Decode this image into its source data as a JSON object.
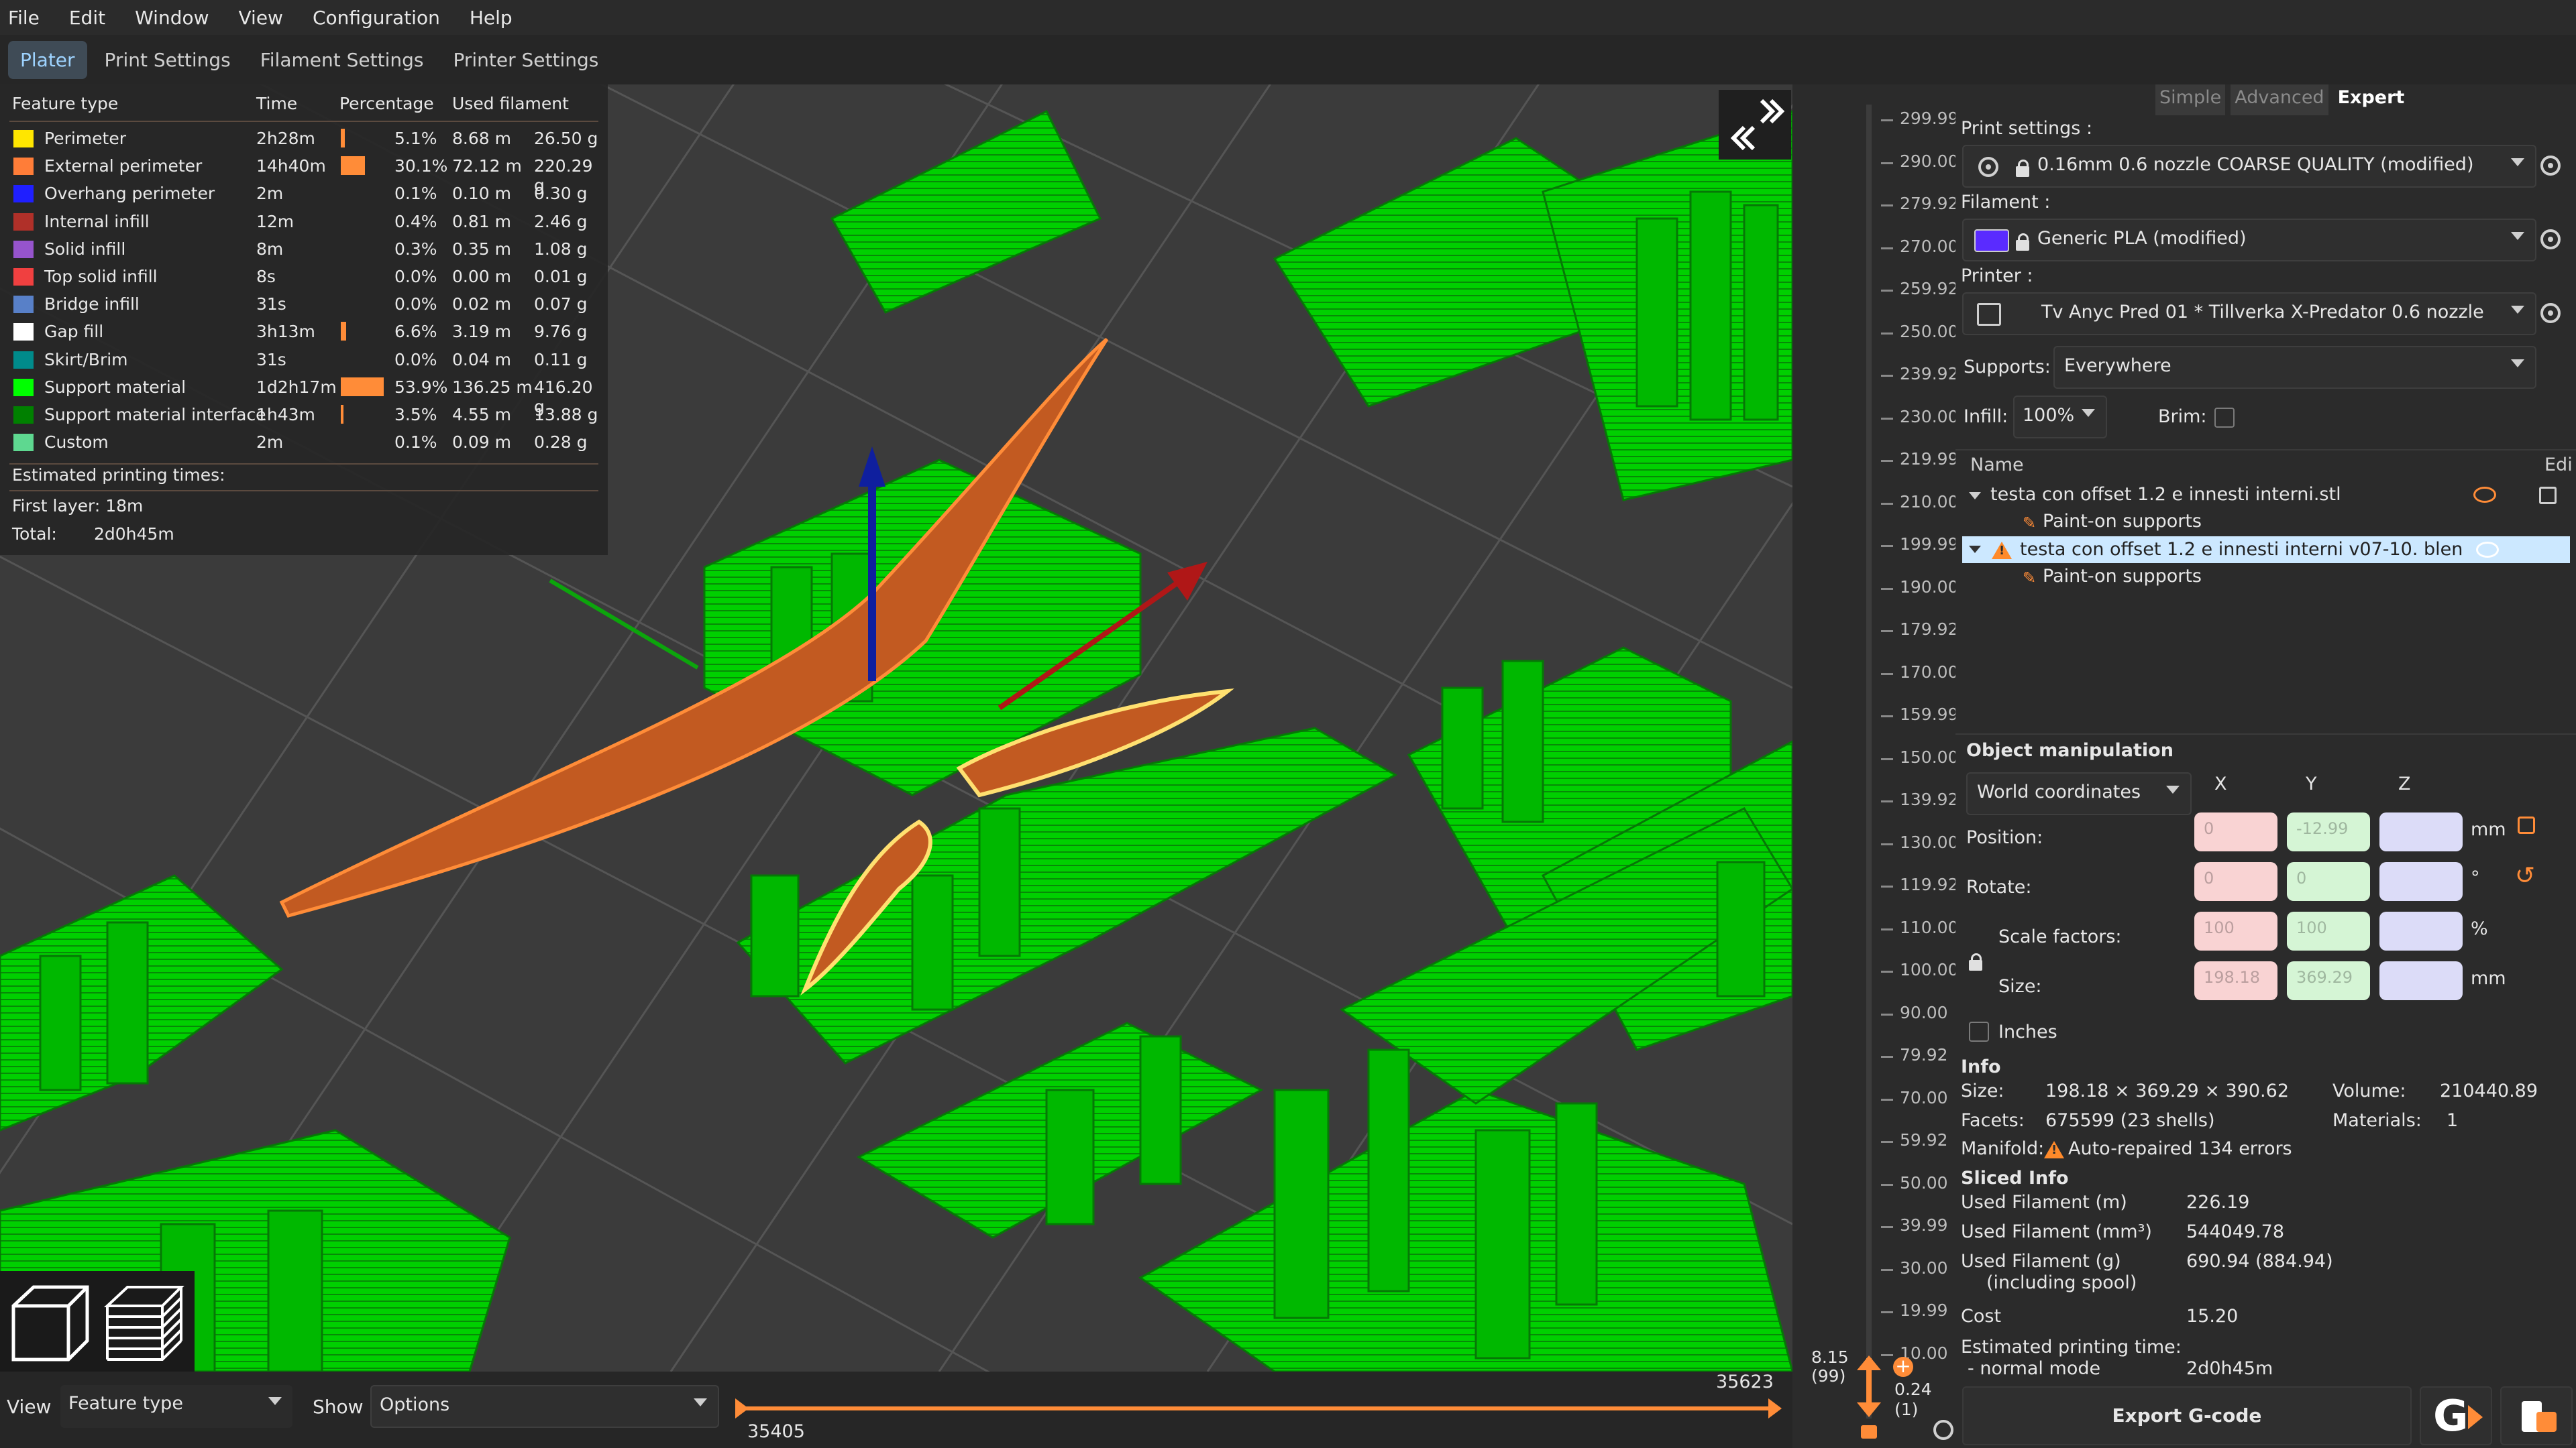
{
  "menu": [
    "File",
    "Edit",
    "Window",
    "View",
    "Configuration",
    "Help"
  ],
  "tabs": [
    {
      "label": "Plater",
      "active": true
    },
    {
      "label": "Print Settings",
      "active": false
    },
    {
      "label": "Filament Settings",
      "active": false
    },
    {
      "label": "Printer Settings",
      "active": false
    }
  ],
  "legend": {
    "headers": {
      "feature": "Feature type",
      "time": "Time",
      "percentage": "Percentage",
      "used": "Used filament"
    },
    "rows": [
      {
        "color": "#ffe600",
        "name": "Perimeter",
        "time": "2h28m",
        "pct": "5.1%",
        "pct_value": 5.1,
        "len": "8.68 m",
        "weight": "26.50 g"
      },
      {
        "color": "#ff7d38",
        "name": "External perimeter",
        "time": "14h40m",
        "pct": "30.1%",
        "pct_value": 30.1,
        "len": "72.12 m",
        "weight": "220.29 g"
      },
      {
        "color": "#1f1fff",
        "name": "Overhang perimeter",
        "time": "2m",
        "pct": "0.1%",
        "pct_value": 0.1,
        "len": "0.10 m",
        "weight": "0.30 g"
      },
      {
        "color": "#b03029",
        "name": "Internal infill",
        "time": "12m",
        "pct": "0.4%",
        "pct_value": 0.4,
        "len": "0.81 m",
        "weight": "2.46 g"
      },
      {
        "color": "#9654cc",
        "name": "Solid infill",
        "time": "8m",
        "pct": "0.3%",
        "pct_value": 0.3,
        "len": "0.35 m",
        "weight": "1.08 g"
      },
      {
        "color": "#f04040",
        "name": "Top solid infill",
        "time": "8s",
        "pct": "0.0%",
        "pct_value": 0.0,
        "len": "0.00 m",
        "weight": "0.01 g"
      },
      {
        "color": "#5880c8",
        "name": "Bridge infill",
        "time": "31s",
        "pct": "0.0%",
        "pct_value": 0.0,
        "len": "0.02 m",
        "weight": "0.07 g"
      },
      {
        "color": "#ffffff",
        "name": "Gap fill",
        "time": "3h13m",
        "pct": "6.6%",
        "pct_value": 6.6,
        "len": "3.19 m",
        "weight": "9.76 g"
      },
      {
        "color": "#008b8b",
        "name": "Skirt/Brim",
        "time": "31s",
        "pct": "0.0%",
        "pct_value": 0.0,
        "len": "0.04 m",
        "weight": "0.11 g"
      },
      {
        "color": "#00ff00",
        "name": "Support material",
        "time": "1d2h17m",
        "pct": "53.9%",
        "pct_value": 53.9,
        "len": "136.25 m",
        "weight": "416.20 g"
      },
      {
        "color": "#008000",
        "name": "Support material interface",
        "time": "1h43m",
        "pct": "3.5%",
        "pct_value": 3.5,
        "len": "4.55 m",
        "weight": "13.88 g"
      },
      {
        "color": "#5ed890",
        "name": "Custom",
        "time": "2m",
        "pct": "0.1%",
        "pct_value": 0.1,
        "len": "0.09 m",
        "weight": "0.28 g"
      }
    ],
    "estimated_label": "Estimated printing times:",
    "first_layer": "First layer: 18m",
    "total_label": "Total:",
    "total_value": "2d0h45m"
  },
  "bottom": {
    "view_label": "View",
    "view_value": "Feature type",
    "show_label": "Show",
    "show_value": "Options",
    "slider_max": "35623",
    "slider_min": "35405"
  },
  "vslider": {
    "ticks": [
      "299.99",
      "290.00",
      "279.92",
      "270.00",
      "259.92",
      "250.00",
      "239.92",
      "230.00",
      "219.99",
      "210.00",
      "199.99",
      "190.00",
      "179.92",
      "170.00",
      "159.99",
      "150.00",
      "139.92",
      "130.00",
      "119.92",
      "110.00",
      "100.00",
      "90.00",
      "79.92",
      "70.00",
      "59.92",
      "50.00",
      "39.99",
      "30.00",
      "19.99",
      "10.00"
    ],
    "current_top": "8.15",
    "current_top_idx": "(99)",
    "current_bottom": "0.24",
    "current_bottom_idx": "(1)"
  },
  "mode": {
    "simple": "Simple",
    "advanced": "Advanced",
    "expert": "Expert"
  },
  "settings": {
    "print_label": "Print settings :",
    "print_value": "0.16mm 0.6 nozzle COARSE QUALITY (modified)",
    "filament_label": "Filament :",
    "filament_value": "Generic PLA (modified)",
    "filament_color": "#5a2bff",
    "printer_label": "Printer :",
    "printer_value": "Tv Anyc Pred 01 * Tillverka X-Predator 0.6 nozzle",
    "supports_label": "Supports:",
    "supports_value": "Everywhere",
    "infill_label": "Infill:",
    "infill_value": "100%",
    "brim_label": "Brim:"
  },
  "objects": {
    "name_header": "Name",
    "edit_header": "Edi",
    "items": [
      {
        "name": "testa con offset 1.2 e innesti interni.stl",
        "child": "Paint-on supports"
      },
      {
        "name": "testa con offset 1.2 e innesti interni v07-10. blen",
        "child": "Paint-on supports"
      }
    ]
  },
  "manip": {
    "title": "Object manipulation",
    "coords": "World coordinates",
    "x": "X",
    "y": "Y",
    "z": "Z",
    "position": "Position:",
    "rotate": "Rotate:",
    "scale": "Scale factors:",
    "size": "Size:",
    "mm": "mm",
    "deg": "°",
    "pct": "%",
    "mm2": "mm",
    "inches": "Inches",
    "pos_vals": [
      "0",
      "-12.99",
      ""
    ],
    "rot_vals": [
      "0",
      "0",
      ""
    ],
    "scale_vals": [
      "100",
      "100",
      ""
    ],
    "size_vals": [
      "198.18",
      "369.29",
      ""
    ]
  },
  "info": {
    "title": "Info",
    "size_k": "Size:",
    "size_v": "198.18 × 369.29 × 390.62",
    "volume_k": "Volume:",
    "volume_v": "210440.89",
    "facets_k": "Facets:",
    "facets_v": "675599 (23 shells)",
    "materials_k": "Materials:",
    "materials_v": "1",
    "manifold_k": "Manifold:",
    "manifold_v": "Auto-repaired 134 errors"
  },
  "sliced": {
    "title": "Sliced Info",
    "fil_m_k": "Used Filament (m)",
    "fil_m_v": "226.19",
    "fil_mm3_k": "Used Filament (mm³)",
    "fil_mm3_v": "544049.78",
    "fil_g_k": "Used Filament (g)",
    "fil_g_k2": "(including spool)",
    "fil_g_v": "690.94 (884.94)",
    "cost_k": "Cost",
    "cost_v": "15.20",
    "est_k": "Estimated printing time:",
    "mode_k": "- normal mode",
    "mode_v": "2d0h45m"
  },
  "export_label": "Export G-code",
  "colors": {
    "accent": "#ff8c38",
    "support": "#00e000",
    "support_dark": "#0a7a0a",
    "selection": "#cce8ff"
  }
}
